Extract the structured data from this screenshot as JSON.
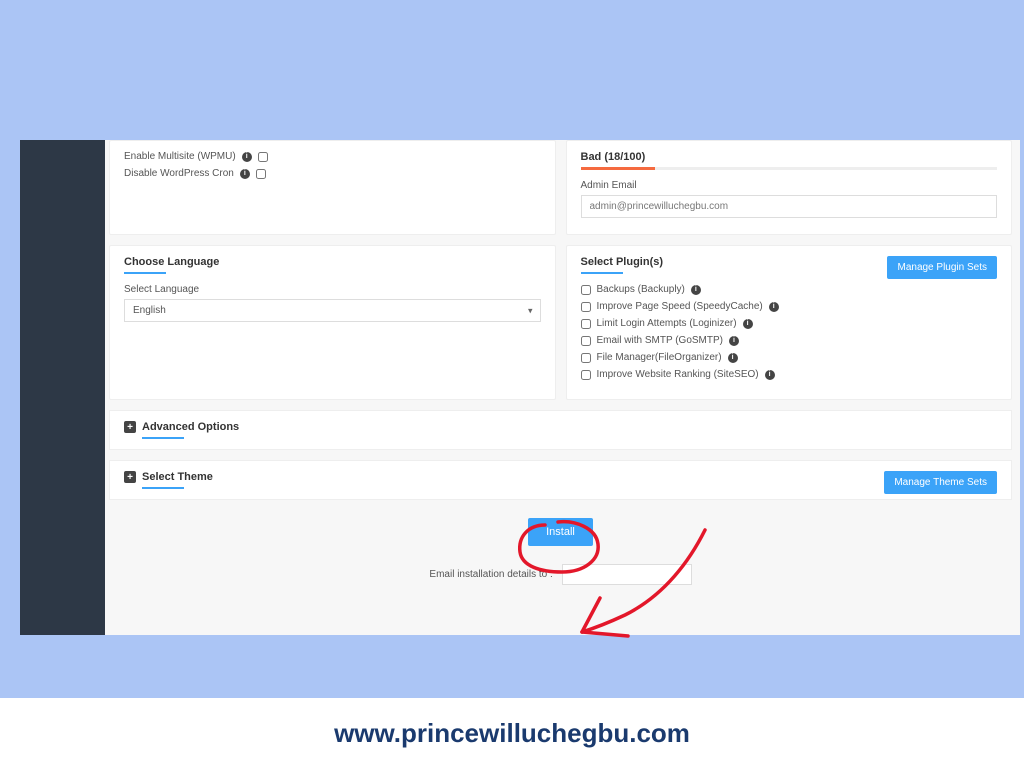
{
  "top_options": {
    "multisite_label": "Enable Multisite (WPMU)",
    "cron_label": "Disable WordPress Cron"
  },
  "security": {
    "score_text": "Bad (18/100)",
    "admin_email_label": "Admin Email",
    "admin_email_value": "admin@princewilluchegbu.com"
  },
  "language": {
    "title": "Choose Language",
    "select_label": "Select Language",
    "value": "English"
  },
  "plugins": {
    "title": "Select Plugin(s)",
    "manage_label": "Manage Plugin Sets",
    "items": [
      "Backups (Backuply)",
      "Improve Page Speed (SpeedyCache)",
      "Limit Login Attempts (Loginizer)",
      "Email with SMTP (GoSMTP)",
      "File Manager(FileOrganizer)",
      "Improve Website Ranking (SiteSEO)"
    ]
  },
  "advanced_title": "Advanced Options",
  "theme": {
    "title": "Select Theme",
    "manage_label": "Manage Theme Sets"
  },
  "install_label": "Install",
  "email_details_label": "Email installation details to :",
  "footer_url": "www.princewilluchegbu.com"
}
